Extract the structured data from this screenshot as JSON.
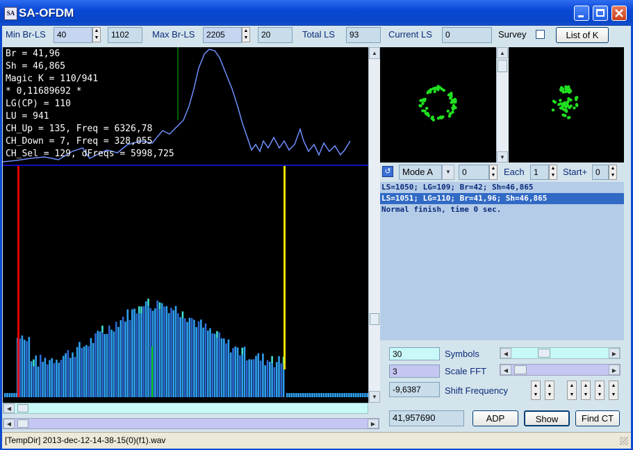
{
  "window": {
    "title": "SA-OFDM",
    "icon_text": "SA"
  },
  "toolbar": {
    "min_br_ls_label": "Min Br-LS",
    "min_br_ls_value": "40",
    "min_br_ls_box": "1102",
    "max_br_ls_label": "Max Br-LS",
    "max_br_ls_value": "2205",
    "max_br_ls_box": "20",
    "total_ls_label": "Total LS",
    "total_ls_value": "93",
    "current_ls_label": "Current LS",
    "current_ls_value": "0",
    "survey_label": "Survey",
    "list_of_k_label": "List of K"
  },
  "info": {
    "lines": [
      "Br = 41,96",
      "Sh = 46,865",
      "Magic K = 110/941",
      "* 0,11689692 *",
      "LG(CP) = 110",
      "LU = 941",
      "CH_Up = 135, Freq = 6326,78",
      "CH_Down = 7, Freq = 328,055",
      "CH_Sel = 129, dFreqs = 5998,725"
    ]
  },
  "mode_row": {
    "mode_value": "Mode A",
    "mode_spin": "0",
    "each_label": "Each",
    "each_value": "1",
    "start_label": "Start+",
    "start_value": "0"
  },
  "log": {
    "lines": [
      "LS=1050; LG=109; Br=42; Sh=46,865",
      "LS=1051; LG=110; Br=41,96; Sh=46,865",
      "Normal finish, time 0 sec."
    ],
    "selected_index": 1
  },
  "controls": {
    "symbols_value": "30",
    "symbols_label": "Symbols",
    "scale_fft_value": "3",
    "scale_fft_label": "Scale FFT",
    "shift_value": "-9,6387",
    "shift_label": "Shift Frequency",
    "readout_value": "41,957690",
    "adp_label": "ADP",
    "show_label": "Show",
    "find_ct_label": "Find CT"
  },
  "statusbar": {
    "text": "[TempDir] 2013-dec-12-14-38-15(0)(f1).wav"
  },
  "colors": {
    "bar_main": "#2ea0f0",
    "bar_alt": "#2d6ad8",
    "bar_cyan": "#40e0d0",
    "marker_red": "#e00000",
    "marker_yellow": "#f0e000",
    "marker_green": "#00c000",
    "trace": "#7090ff",
    "constellation": "#20e020"
  }
}
